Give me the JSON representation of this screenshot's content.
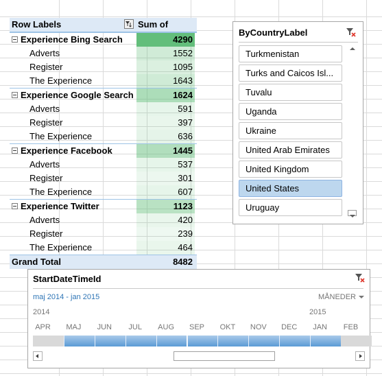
{
  "pivot": {
    "header": {
      "row_labels": "Row Labels",
      "sum_label": "Sum of Visits"
    },
    "groups": [
      {
        "label": "Experience Bing Search",
        "total": "4290",
        "children": [
          {
            "label": "Adverts",
            "value": "1552"
          },
          {
            "label": "Register",
            "value": "1095"
          },
          {
            "label": "The Experience",
            "value": "1643"
          }
        ]
      },
      {
        "label": "Experience Google Search",
        "total": "1624",
        "children": [
          {
            "label": "Adverts",
            "value": "591"
          },
          {
            "label": "Register",
            "value": "397"
          },
          {
            "label": "The Experience",
            "value": "636"
          }
        ]
      },
      {
        "label": "Experience Facebook",
        "total": "1445",
        "children": [
          {
            "label": "Adverts",
            "value": "537"
          },
          {
            "label": "Register",
            "value": "301"
          },
          {
            "label": "The Experience",
            "value": "607"
          }
        ]
      },
      {
        "label": "Experience Twitter",
        "total": "1123",
        "children": [
          {
            "label": "Adverts",
            "value": "420"
          },
          {
            "label": "Register",
            "value": "239"
          },
          {
            "label": "The Experience",
            "value": "464"
          }
        ]
      }
    ],
    "grand_total": {
      "label": "Grand Total",
      "value": "8482"
    },
    "data_bar_color": "#63be7b"
  },
  "country_slicer": {
    "title": "ByCountryLabel",
    "items": [
      {
        "label": "Turkmenistan",
        "selected": false
      },
      {
        "label": "Turks and Caicos Isl...",
        "selected": false
      },
      {
        "label": "Tuvalu",
        "selected": false
      },
      {
        "label": "Uganda",
        "selected": false
      },
      {
        "label": "Ukraine",
        "selected": false
      },
      {
        "label": "United Arab Emirates",
        "selected": false
      },
      {
        "label": "United Kingdom",
        "selected": false
      },
      {
        "label": "United States",
        "selected": true
      },
      {
        "label": "Uruguay",
        "selected": false
      }
    ],
    "selected_color": "#bdd7ee"
  },
  "timeline": {
    "title": "StartDateTimeId",
    "range_label": "maj 2014 - jan 2015",
    "level": "MÅNEDER",
    "years": [
      "2014",
      "2015"
    ],
    "months": [
      "APR",
      "MAJ",
      "JUN",
      "JUL",
      "AUG",
      "SEP",
      "OKT",
      "NOV",
      "DEC",
      "JAN",
      "FEB"
    ],
    "selected_months": [
      false,
      true,
      true,
      true,
      true,
      true,
      true,
      true,
      true,
      true,
      false
    ],
    "accent_color": "#5b9bd5"
  }
}
